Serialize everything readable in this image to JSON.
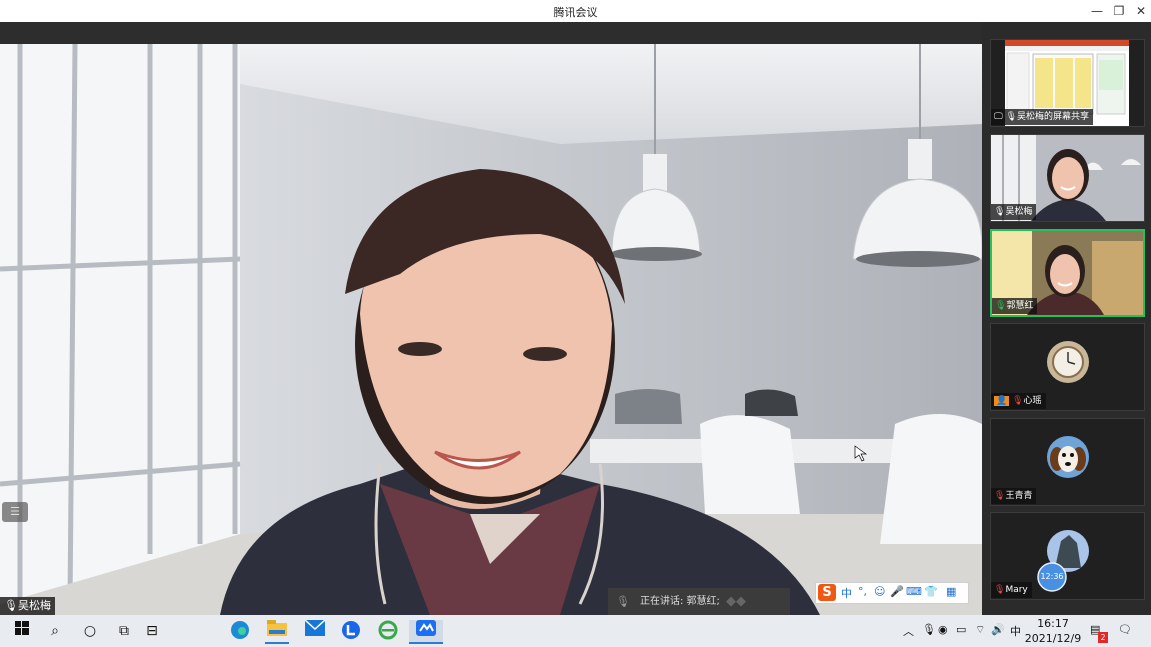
{
  "window": {
    "title": "腾讯会议",
    "minimize_glyph": "—",
    "restore_glyph": "❐",
    "close_glyph": "✕"
  },
  "main_video": {
    "speaker_name": "吴松梅",
    "list_button_glyph": "☰"
  },
  "speaking_indicator": {
    "text": "正在讲话: 郭慧红;"
  },
  "ime_toolbar": {
    "logo": "S",
    "lang": "中",
    "punct": "°,",
    "icons": [
      "☺",
      "🎤",
      "⌨",
      "👕",
      "▦"
    ]
  },
  "participants": [
    {
      "name": "吴松梅的屏幕共享",
      "type": "screen-share",
      "active": false
    },
    {
      "name": "吴松梅",
      "type": "video",
      "active": false
    },
    {
      "name": "郭慧红",
      "type": "video",
      "active": true
    },
    {
      "name": "心瑶",
      "type": "avatar",
      "avatar_icon": "pocket-watch-icon",
      "active": false
    },
    {
      "name": "王青青",
      "type": "avatar",
      "avatar_icon": "puppy-icon",
      "active": false
    },
    {
      "name": "Mary",
      "type": "avatar",
      "avatar_icon": "statue-icon",
      "badge": "12:36",
      "active": false
    }
  ],
  "taskbar": {
    "apps": [
      "start",
      "search",
      "task-view",
      "widgets",
      "snap",
      "edge",
      "file-explorer",
      "mail",
      "lark",
      "ie",
      "tencent-meeting"
    ],
    "tray_ime": "中",
    "time": "16:17",
    "date": "2021/12/9",
    "notification_badge": "2"
  },
  "colors": {
    "active_border": "#27c05a",
    "ime_logo": "#ee5a14"
  }
}
